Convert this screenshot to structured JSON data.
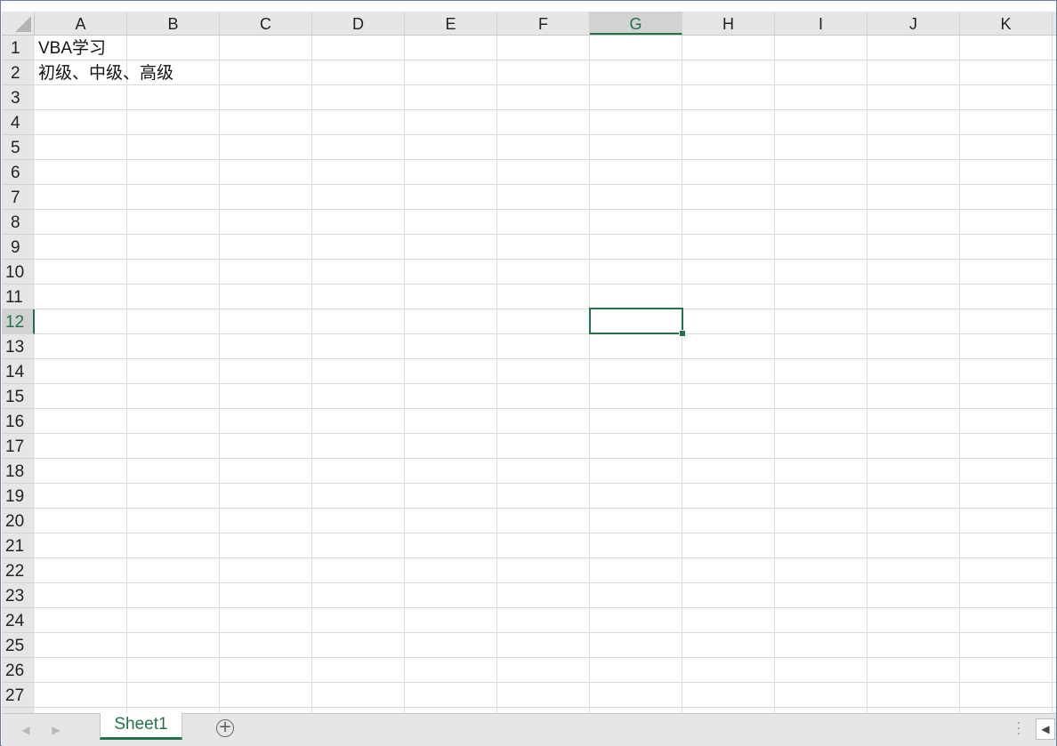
{
  "columns": [
    "A",
    "B",
    "C",
    "D",
    "E",
    "F",
    "G",
    "H",
    "I",
    "J",
    "K"
  ],
  "rows": [
    "1",
    "2",
    "3",
    "4",
    "5",
    "6",
    "7",
    "8",
    "9",
    "10",
    "11",
    "12",
    "13",
    "14",
    "15",
    "16",
    "17",
    "18",
    "19",
    "20",
    "21",
    "22",
    "23",
    "24",
    "25",
    "26",
    "27"
  ],
  "active_cell": {
    "column": "G",
    "row": "12"
  },
  "cells": [
    {
      "ref": "A1",
      "value": "VBA学习"
    },
    {
      "ref": "A2",
      "value": "初级、中级、高级"
    }
  ],
  "sheet_tabs": [
    {
      "label": "Sheet1",
      "active": true
    }
  ],
  "icons": {
    "select_all": "select-all-triangle",
    "prev_sheet": "◀",
    "next_sheet": "▶",
    "add_sheet": "+",
    "split": "⋮",
    "scroll_left": "◀"
  },
  "colors": {
    "accent": "#217346",
    "header_bg": "#e6e6e6",
    "gridline": "#dadada"
  }
}
